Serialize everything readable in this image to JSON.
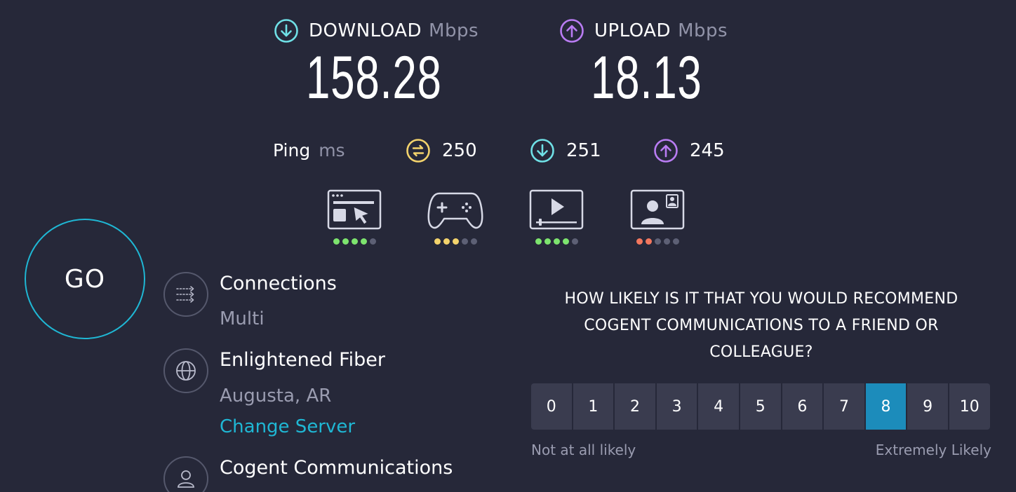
{
  "download": {
    "label": "DOWNLOAD",
    "unit": "Mbps",
    "value": "158.28",
    "icon": "download-arrow-icon",
    "color": "#6fe0e6"
  },
  "upload": {
    "label": "UPLOAD",
    "unit": "Mbps",
    "value": "18.13",
    "icon": "upload-arrow-icon",
    "color": "#b97cf3"
  },
  "ping": {
    "label": "Ping",
    "unit": "ms",
    "idle": {
      "value": "250",
      "icon": "idle-latency-icon",
      "color": "#f3d36c"
    },
    "download": {
      "value": "251",
      "icon": "download-latency-icon",
      "color": "#6fe0e6"
    },
    "upload": {
      "value": "245",
      "icon": "upload-latency-icon",
      "color": "#b97cf3"
    }
  },
  "quality": [
    {
      "icon": "web-browsing-icon",
      "rating": 4,
      "color": "#7de46e"
    },
    {
      "icon": "gaming-icon",
      "rating": 3,
      "color": "#f3d36c"
    },
    {
      "icon": "video-streaming-icon",
      "rating": 4,
      "color": "#7de46e"
    },
    {
      "icon": "video-call-icon",
      "rating": 2,
      "color": "#f3775e"
    }
  ],
  "go_label": "GO",
  "connections": {
    "title": "Connections",
    "value": "Multi",
    "icon": "connections-icon"
  },
  "server": {
    "title": "Enlightened Fiber",
    "location": "Augusta, AR",
    "change_label": "Change Server",
    "icon": "globe-icon"
  },
  "provider": {
    "title": "Cogent Communications",
    "icon": "user-icon"
  },
  "survey": {
    "question": "HOW LIKELY IS IT THAT YOU WOULD RECOMMEND COGENT COMMUNICATIONS TO A FRIEND OR COLLEAGUE?",
    "options": [
      "0",
      "1",
      "2",
      "3",
      "4",
      "5",
      "6",
      "7",
      "8",
      "9",
      "10"
    ],
    "selected": "8",
    "low_label": "Not at all likely",
    "high_label": "Extremely Likely",
    "selected_color": "#1c8cbb"
  }
}
